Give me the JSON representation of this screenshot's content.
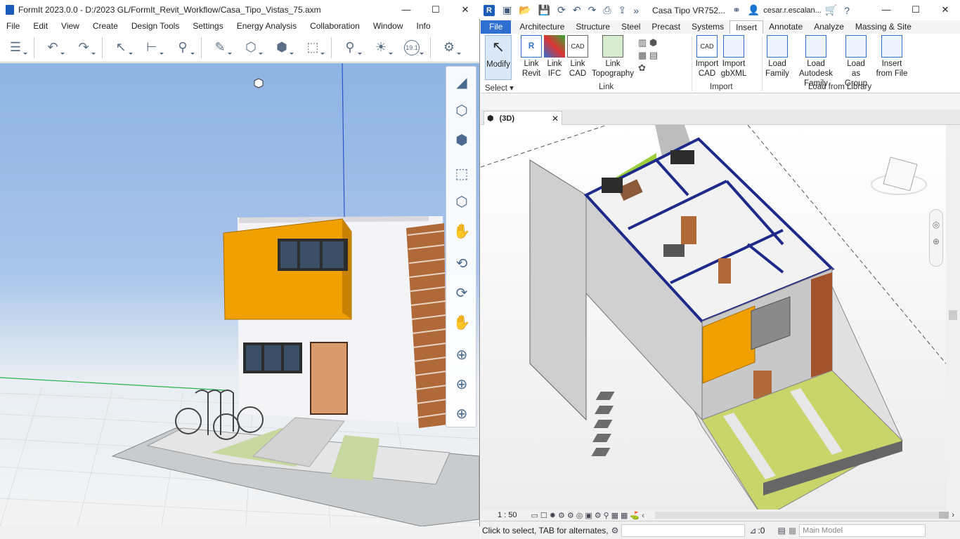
{
  "formit": {
    "title": "FormIt 2023.0.0 - D:/2023 GL/FormIt_Revit_Workflow/Casa_Tipo_Vistas_75.axm",
    "menu": [
      "File",
      "Edit",
      "View",
      "Create",
      "Design Tools",
      "Settings",
      "Energy Analysis",
      "Collaboration",
      "Window",
      "Info"
    ],
    "window_buttons": {
      "minimize": "—",
      "maximize": "☐",
      "close": "✕"
    },
    "tools": [
      "layers-icon",
      "undo-icon",
      "redo-icon",
      "select-icon",
      "measure-icon",
      "paint-icon",
      "draw-icon",
      "solid-icon",
      "tools-icon",
      "group-icon",
      "location-icon",
      "sun-icon",
      "level-icon",
      "settings-icon"
    ],
    "level_badge": "19.1",
    "nav_icons": [
      "house-shading-icon",
      "cube-front-icon",
      "cube-iso-icon",
      "zoom-extents-icon",
      "orbit-cube-icon",
      "walk-icon",
      "orbit-icon",
      "turntable-icon",
      "pan-icon",
      "zoom-icon",
      "zoom-window-icon",
      "zoom-selected-icon"
    ],
    "accent": "#f0a000"
  },
  "revit": {
    "title_doc": "Casa Tipo VR752...",
    "user": "cesar.r.escalan...",
    "logo": "R",
    "window_buttons": {
      "minimize": "—",
      "maximize": "☐",
      "close": "✕"
    },
    "tabs": [
      "File",
      "Architecture",
      "Structure",
      "Steel",
      "Precast",
      "Systems",
      "Insert",
      "Annotate",
      "Analyze",
      "Massing & Site"
    ],
    "active_tab": "Insert",
    "ribbon": {
      "select": {
        "label": "Modify",
        "group": "Select"
      },
      "link": {
        "group": "Link",
        "buttons": [
          {
            "l1": "Link",
            "l2": "Revit"
          },
          {
            "l1": "Link",
            "l2": "IFC"
          },
          {
            "l1": "Link",
            "l2": "CAD"
          },
          {
            "l1": "Link",
            "l2": "Topography"
          }
        ]
      },
      "import": {
        "group": "Import",
        "buttons": [
          {
            "l1": "Import",
            "l2": "CAD"
          },
          {
            "l1": "Import",
            "l2": "gbXML"
          }
        ]
      },
      "library": {
        "group": "Load from Library",
        "buttons": [
          {
            "l1": "Load",
            "l2": "Family"
          },
          {
            "l1": "Load Autodesk",
            "l2": "Family"
          },
          {
            "l1": "Load as",
            "l2": "Group"
          },
          {
            "l1": "Insert",
            "l2": "from File"
          }
        ]
      }
    },
    "view_tab": "(3D)",
    "view_tab_close": "✕",
    "scale": "1 : 50",
    "status_text": "Click to select, TAB for alternates, ",
    "selection_count": ":0",
    "model_dropdown": "Main Model",
    "brand": "#2f6fd0"
  }
}
